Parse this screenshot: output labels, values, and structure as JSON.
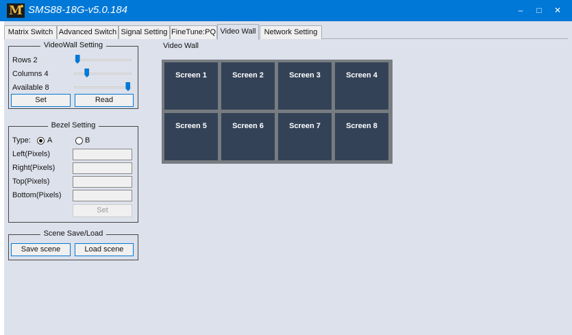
{
  "window": {
    "title": "SMS88-18G-v5.0.184",
    "logo_letter": "M",
    "minimize_glyph": "–",
    "maximize_glyph": "□",
    "close_glyph": "✕"
  },
  "tabs": [
    {
      "label": "Matrix Switch",
      "active": false
    },
    {
      "label": "Advanced Switch",
      "active": false
    },
    {
      "label": "Signal Setting",
      "active": false
    },
    {
      "label": "FineTune:PQ",
      "active": false
    },
    {
      "label": "Video Wall",
      "active": true
    },
    {
      "label": "Network Setting",
      "active": false
    }
  ],
  "videowall_setting": {
    "legend": "VideoWall Setting",
    "rows_label": "Rows 2",
    "rows_value": 2,
    "rows_fraction": 0.02,
    "columns_label": "Columns 4",
    "columns_value": 4,
    "columns_fraction": 0.2,
    "available_label": "Available 8",
    "available_value": 8,
    "available_fraction": 0.98,
    "set_button": "Set",
    "read_button": "Read"
  },
  "bezel_setting": {
    "legend": "Bezel Setting",
    "type_label": "Type:",
    "option_a": "A",
    "option_b": "B",
    "selected": "A",
    "left_label": "Left(Pixels)",
    "right_label": "Right(Pixels)",
    "top_label": "Top(Pixels)",
    "bottom_label": "Bottom(Pixels)",
    "set_button": "Set"
  },
  "scene": {
    "legend": "Scene Save/Load",
    "save_button": "Save scene",
    "load_button": "Load scene"
  },
  "video_wall": {
    "title": "Video Wall",
    "screens": [
      "Screen 1",
      "Screen 2",
      "Screen 3",
      "Screen 4",
      "Screen 5",
      "Screen 6",
      "Screen 7",
      "Screen 8"
    ]
  },
  "colors": {
    "titlebar": "#0078d7",
    "background": "#dde1eb",
    "screen_tile": "#344257",
    "wall_frame": "#777c80",
    "accent": "#0078d7"
  }
}
